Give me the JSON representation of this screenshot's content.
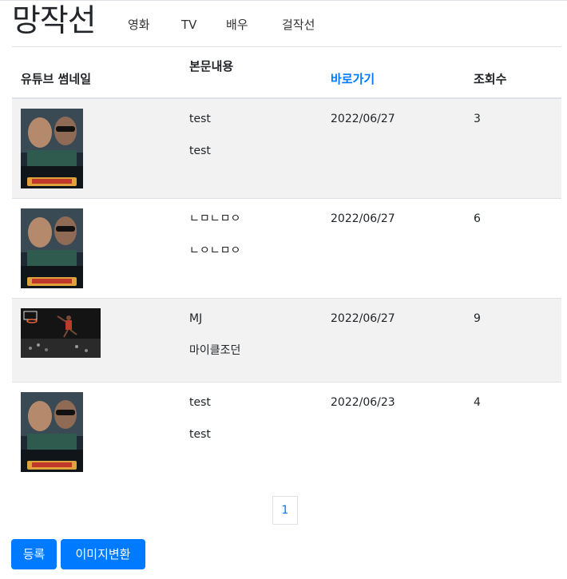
{
  "navbar": {
    "brand": "망작선",
    "links": [
      "영화",
      "TV",
      "배우",
      "걸작선"
    ]
  },
  "table": {
    "headers": {
      "thumbnail": "유튜브 썸네일",
      "content": "본문내용",
      "link": "바로가기",
      "views": "조회수"
    },
    "rows": [
      {
        "title": "test",
        "body": "test",
        "date": "2022/06/27",
        "views": "3",
        "thumbnail": "poster"
      },
      {
        "title": "ㄴㅁㄴㅁㅇ",
        "body": "ㄴㅇㄴㅁㅇ",
        "date": "2022/06/27",
        "views": "6",
        "thumbnail": "poster"
      },
      {
        "title": "MJ",
        "body": "마이클조던",
        "date": "2022/06/27",
        "views": "9",
        "thumbnail": "basketball"
      },
      {
        "title": "test",
        "body": "test",
        "date": "2022/06/23",
        "views": "4",
        "thumbnail": "poster"
      }
    ]
  },
  "pagination": {
    "current": "1"
  },
  "buttons": {
    "register": "등록",
    "convert": "이미지변환"
  },
  "colors": {
    "accent": "#007bff",
    "stripe": "#f2f2f2"
  }
}
